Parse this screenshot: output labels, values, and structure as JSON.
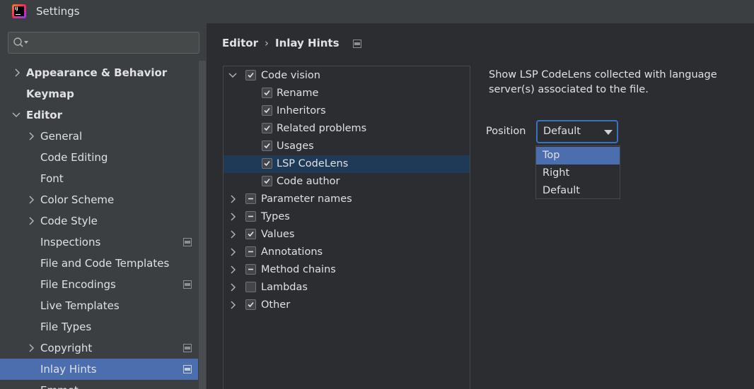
{
  "window": {
    "title": "Settings",
    "logo_text": "IJ"
  },
  "search": {
    "placeholder": ""
  },
  "sidebar": {
    "items": [
      {
        "label": "Appearance & Behavior"
      },
      {
        "label": "Keymap"
      },
      {
        "label": "Editor"
      },
      {
        "label": "General"
      },
      {
        "label": "Code Editing"
      },
      {
        "label": "Font"
      },
      {
        "label": "Color Scheme"
      },
      {
        "label": "Code Style"
      },
      {
        "label": "Inspections"
      },
      {
        "label": "File and Code Templates"
      },
      {
        "label": "File Encodings"
      },
      {
        "label": "Live Templates"
      },
      {
        "label": "File Types"
      },
      {
        "label": "Copyright"
      },
      {
        "label": "Inlay Hints"
      },
      {
        "label": "Emmet"
      }
    ]
  },
  "breadcrumb": {
    "parent": "Editor",
    "separator": "›",
    "current": "Inlay Hints"
  },
  "tree": {
    "items": [
      {
        "label": "Code vision",
        "state": "checked"
      },
      {
        "label": "Rename",
        "state": "checked"
      },
      {
        "label": "Inheritors",
        "state": "checked"
      },
      {
        "label": "Related problems",
        "state": "checked"
      },
      {
        "label": "Usages",
        "state": "checked"
      },
      {
        "label": "LSP CodeLens",
        "state": "checked"
      },
      {
        "label": "Code author",
        "state": "checked"
      },
      {
        "label": "Parameter names",
        "state": "partial"
      },
      {
        "label": "Types",
        "state": "partial"
      },
      {
        "label": "Values",
        "state": "checked"
      },
      {
        "label": "Annotations",
        "state": "partial"
      },
      {
        "label": "Method chains",
        "state": "partial"
      },
      {
        "label": "Lambdas",
        "state": "unchecked"
      },
      {
        "label": "Other",
        "state": "checked"
      }
    ]
  },
  "details": {
    "description": "Show LSP CodeLens collected with language server(s) associated to the file.",
    "position_label": "Position",
    "position_value": "Default",
    "options": [
      "Top",
      "Right",
      "Default"
    ],
    "highlighted_option": "Top"
  },
  "colors": {
    "selection": "#4b6eaf",
    "tree_selection": "#1f3a56",
    "focus_border": "#3574c2",
    "background": "#2b2d30",
    "sidebar_background": "#3c3f41"
  }
}
